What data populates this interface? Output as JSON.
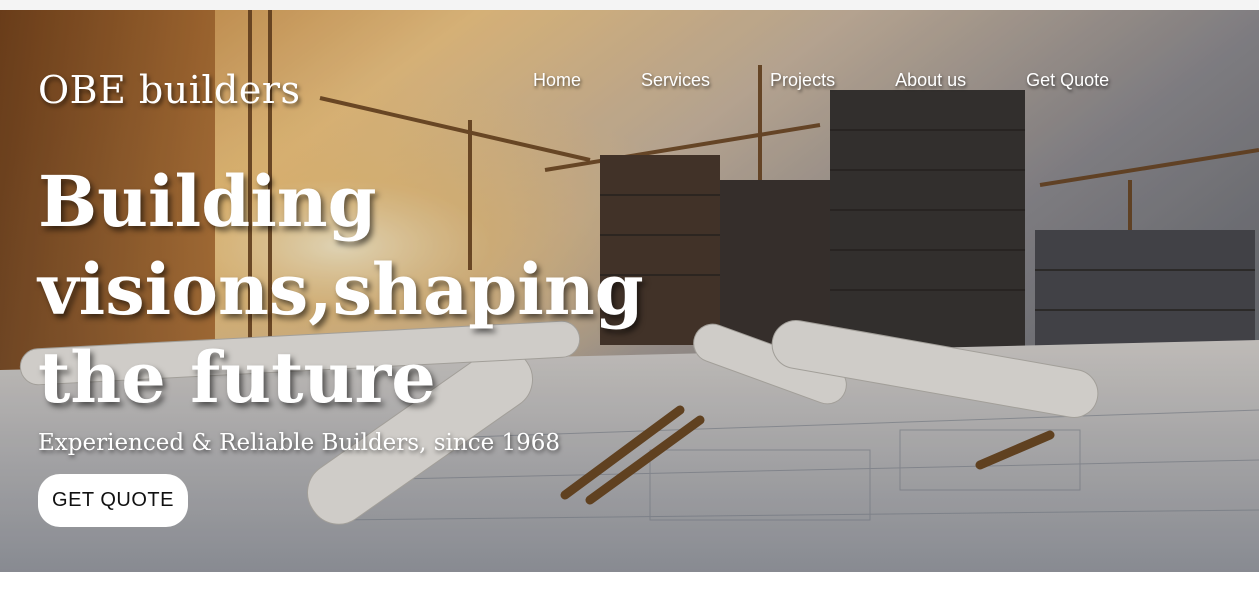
{
  "brand": {
    "name": "OBE builders"
  },
  "nav": {
    "items": [
      {
        "label": "Home"
      },
      {
        "label": "Services"
      },
      {
        "label": "Projects"
      },
      {
        "label": "About us"
      },
      {
        "label": "Get Quote"
      }
    ]
  },
  "hero": {
    "headline_lines": [
      "Building",
      "visions,shaping",
      "the future"
    ],
    "tagline": "Experienced & Reliable Builders, since 1968",
    "cta_label": "GET QUOTE",
    "background": "construction-site-sunset-photo"
  },
  "colors": {
    "text": "#ffffff",
    "cta_bg": "#ffffff",
    "cta_text": "#111111"
  }
}
